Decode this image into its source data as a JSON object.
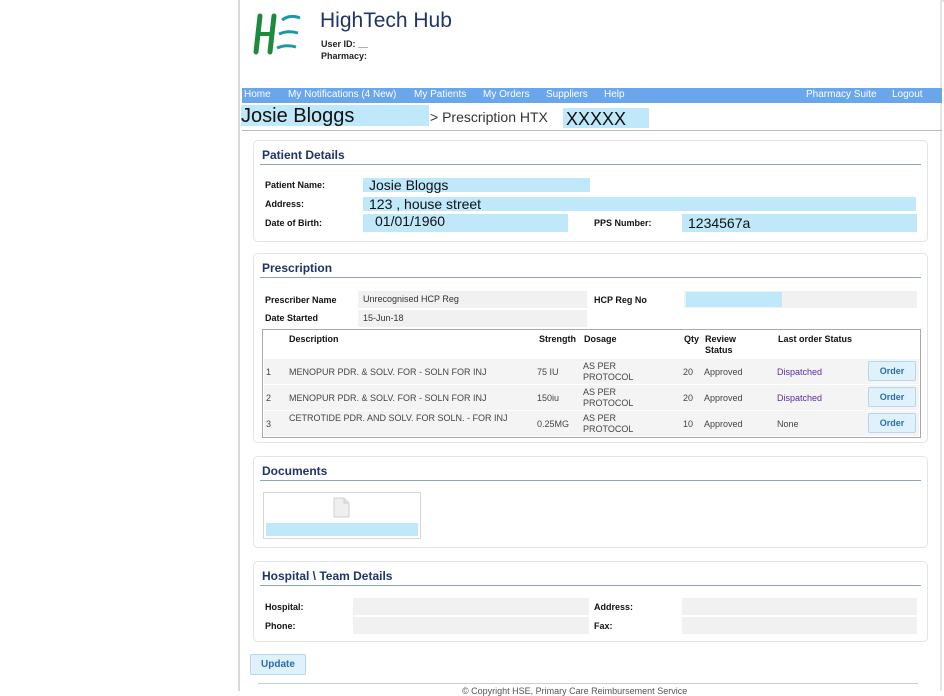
{
  "header": {
    "app_title": "HighTech Hub",
    "user_id_label": "User ID: __",
    "pharmacy_label": "Pharmacy:"
  },
  "nav": {
    "home": "Home",
    "notifications": "My Notifications (4 New)",
    "patients": "My Patients",
    "orders": "My Orders",
    "suppliers": "Suppliers",
    "help": "Help",
    "pharmacy_suite": "Pharmacy Suite",
    "logout": "Logout"
  },
  "title": {
    "patient_name": "Josie Bloggs",
    "crumb": "> Prescription HTX",
    "htx_number": "XXXXX"
  },
  "patient_details": {
    "heading": "Patient Details",
    "name_label": "Patient Name:",
    "name_value": "Josie Bloggs",
    "address_label": "Address:",
    "address_value": "123 , house street",
    "dob_label": "Date of Birth:",
    "dob_value": "01/01/1960",
    "pps_label": "PPS Number:",
    "pps_value": "1234567a"
  },
  "prescription": {
    "heading": "Prescription",
    "prescriber_label": "Prescriber Name",
    "prescriber_value": "Unrecognised HCP Reg",
    "hcp_reg_label": "HCP Reg No",
    "date_label": "Date Started",
    "date_value": "15-Jun-18",
    "columns": {
      "description": "Description",
      "strength": "Strength",
      "dosage": "Dosage",
      "qty": "Qty",
      "review_status": "Review Status",
      "last_order_status": "Last order Status"
    },
    "rows": [
      {
        "num": "1",
        "description": "MENOPUR PDR. & SOLV. FOR - SOLN FOR INJ",
        "strength": "75 IU",
        "dosage": "AS PER PROTOCOL",
        "qty": "20",
        "review": "Approved",
        "last_order": "Dispatched",
        "button": "Order"
      },
      {
        "num": "2",
        "description": "MENOPUR PDR. & SOLV. FOR - SOLN FOR INJ",
        "strength": "150iu",
        "dosage": "AS PER PROTOCOL",
        "qty": "20",
        "review": "Approved",
        "last_order": "Dispatched",
        "button": "Order"
      },
      {
        "num": "3",
        "description": "CETROTIDE PDR. AND SOLV. FOR SOLN. - FOR INJ",
        "strength": "0.25MG",
        "dosage": "AS PER PROTOCOL",
        "qty": "10",
        "review": "Approved",
        "last_order": "None",
        "button": "Order"
      }
    ]
  },
  "documents": {
    "heading": "Documents",
    "icon": "document-icon"
  },
  "hospital": {
    "heading": "Hospital \\ Team Details",
    "hospital_label": "Hospital:",
    "address_label": "Address:",
    "phone_label": "Phone:",
    "fax_label": "Fax:"
  },
  "actions": {
    "update": "Update"
  },
  "footer": {
    "copyright": "© Copyright HSE, Primary Care Reimbursement Service"
  },
  "colors": {
    "nav_bg": "#6aa6ec",
    "highlight": "#bfe8fb",
    "title_blue": "#1f3566",
    "logo_green": "#1e8b3c",
    "logo_teal": "#1a9aa8"
  }
}
